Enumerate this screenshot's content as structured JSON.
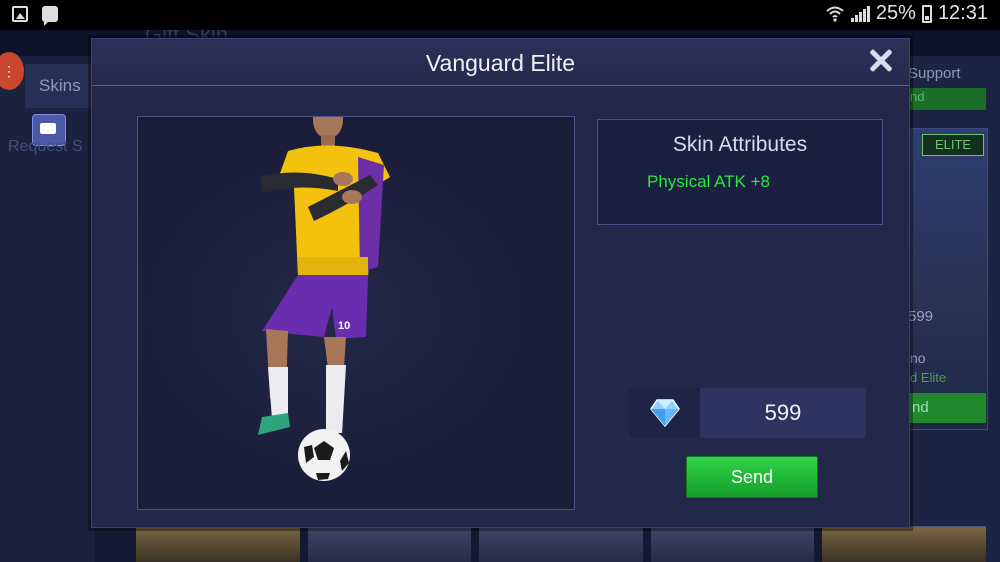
{
  "status_bar": {
    "battery_percent": "25%",
    "time": "12:31",
    "icons": [
      "gallery-icon",
      "bbm-icon",
      "wifi-icon",
      "signal-icon",
      "battery-icon"
    ]
  },
  "background": {
    "header_text": "Gift Skin",
    "tab_skins": "Skins",
    "tab_request": "Request S",
    "support": "Support",
    "green_strip": "nd",
    "elite_badge": "ELITE",
    "price_partial": "599",
    "name_partial": "no",
    "skin_partial": "d Elite",
    "send_partial": "nd",
    "badge_icon": "menu-icon"
  },
  "modal": {
    "title": "Vanguard Elite",
    "close_icon": "close-icon",
    "attributes": {
      "heading": "Skin Attributes",
      "value": "Physical ATK +8"
    },
    "price": {
      "currency_icon": "diamond-icon",
      "amount": "599"
    },
    "send_label": "Send",
    "hero_preview": "footballer-skin-preview",
    "jersey_number": "10"
  },
  "colors": {
    "accent_green": "#27e93b",
    "button_green": "#21b635",
    "modal_bg": "#23274a"
  }
}
